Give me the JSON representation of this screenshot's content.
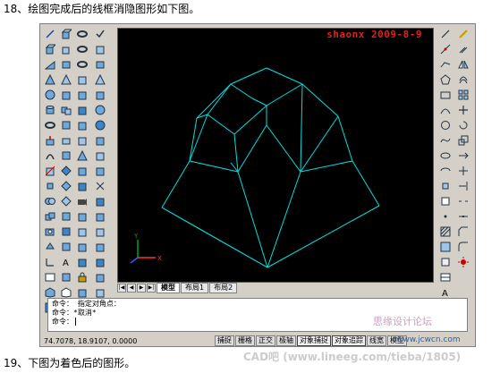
{
  "steps": {
    "step18": "18、绘图完成后的线框消隐图形如下图。",
    "step19": "19、下图为着色后的图形。"
  },
  "canvas": {
    "signature": "shaonx 2009-8-9",
    "background": "#000000",
    "line_color": "#00e0e0"
  },
  "tabs": {
    "model": "模型",
    "layout1": "布局1",
    "layout2": "布局2"
  },
  "command": {
    "line1": "命令： 指定对角点：",
    "line2": "命令：*取消*",
    "prompt": "命令："
  },
  "status": {
    "coords": "74.7078,  18.9107, 0.0000",
    "buttons": [
      "捕捉",
      "栅格",
      "正交",
      "极轴",
      "对象捕捉",
      "对象追踪",
      "线宽",
      "模型"
    ]
  },
  "watermarks": {
    "site": "思缘设计论坛",
    "url": "www.jcwcn.com",
    "footer": "CAD吧 (www.lineeg.com/tieba/1805)"
  },
  "toolbar_left_1": [
    "line-icon",
    "box-icon",
    "box-icon",
    "box-icon",
    "box-icon",
    "box-icon",
    "box-icon",
    "box-icon",
    "box-icon",
    "box-icon",
    "box-icon",
    "box-icon",
    "box-icon",
    "box-icon",
    "box-icon",
    "box-icon",
    "box-icon",
    "box-icon",
    "box-icon"
  ],
  "toolbar_right_1": [
    "slash-icon",
    "xline-icon",
    "pline-icon",
    "polygon-icon",
    "rect-icon",
    "arc-icon",
    "circle-icon",
    "spline-icon",
    "ellipse-icon",
    "ellipse-arc-icon",
    "insert-icon",
    "block-icon",
    "point-icon",
    "hatch-icon",
    "gradient-icon",
    "region-icon",
    "table-icon",
    "text-icon"
  ],
  "toolbar_right_2": [
    "erase-icon",
    "copy-icon",
    "mirror-icon",
    "offset-icon",
    "array-icon",
    "move-icon",
    "rotate-icon",
    "scale-icon",
    "stretch-icon",
    "trim-icon",
    "extend-icon",
    "break-icon",
    "join-icon",
    "chamfer-icon",
    "fillet-icon",
    "explode-icon"
  ]
}
